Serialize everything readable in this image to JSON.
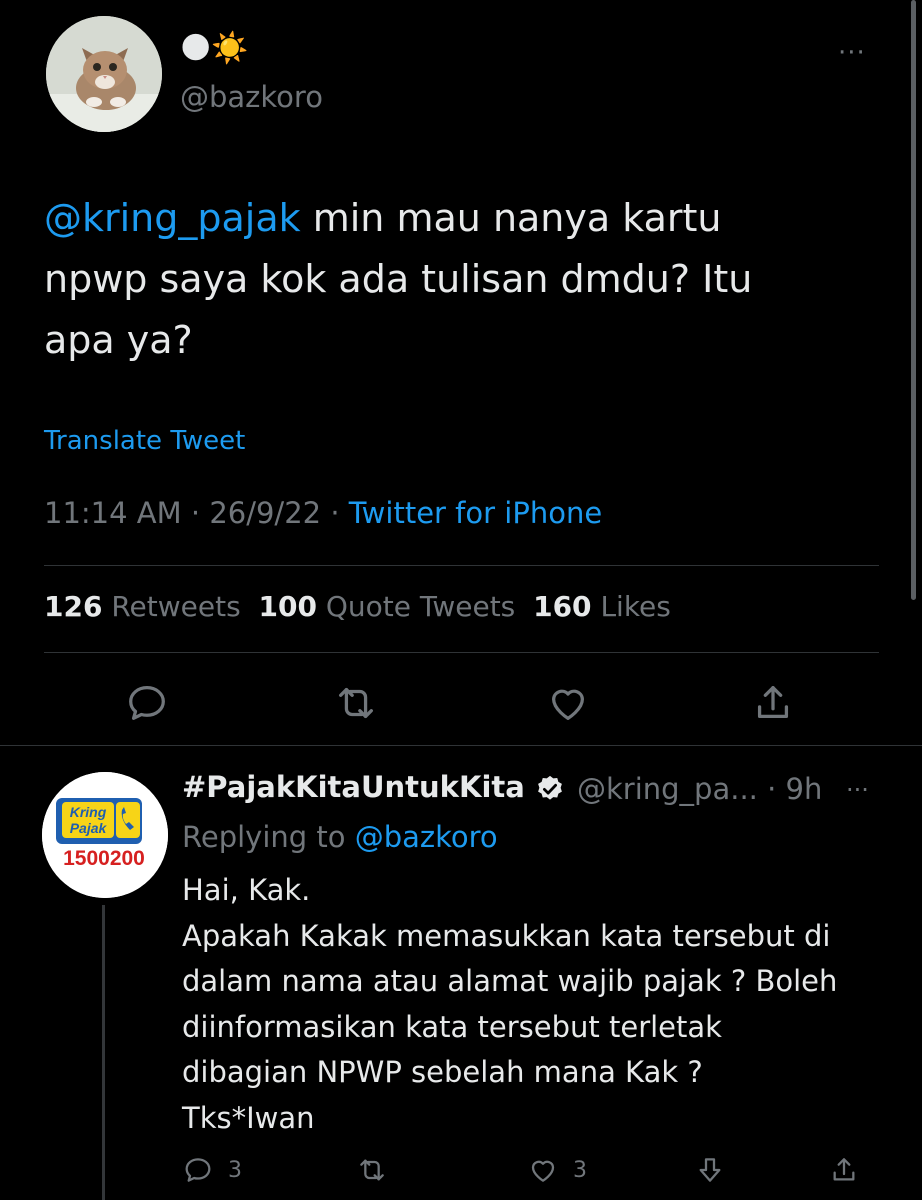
{
  "main_tweet": {
    "name_emoji": "🌑☀️",
    "handle": "@bazkoro",
    "more": "···",
    "text": {
      "mention": "@kring_pajak",
      "line1_rest": " min mau nanya kartu",
      "line2": "npwp saya kok ada tulisan dmdu? Itu",
      "line3": "apa ya?"
    },
    "translate": "Translate Tweet",
    "time": "11:14 AM",
    "date": "26/9/22",
    "source": "Twitter for iPhone",
    "separator": " · ",
    "stats": {
      "retweets_count": "126",
      "retweets_label": "Retweets",
      "quotes_count": "100",
      "quotes_label": "Quote Tweets",
      "likes_count": "160",
      "likes_label": "Likes"
    }
  },
  "reply": {
    "avatar": {
      "line1": "Kring",
      "line2": "Pajak",
      "number": "1500200"
    },
    "name": "#PajakKitaUntukKita",
    "handle_time": "@kring_pa... · 9h",
    "more": "···",
    "replying_prefix": "Replying to ",
    "replying_mention": "@bazkoro",
    "text_lines": [
      "Hai, Kak.",
      "Apakah Kakak memasukkan kata tersebut di",
      "dalam nama atau alamat wajib pajak ? Boleh",
      "diinformasikan kata tersebut terletak",
      "dibagian NPWP sebelah mana Kak ?",
      "Tks*Iwan"
    ],
    "actions": {
      "reply_count": "3",
      "like_count": "3"
    }
  },
  "colors": {
    "background": "#000000",
    "accent": "#1d9bf0",
    "muted": "#71767b",
    "text": "#e7e9ea"
  }
}
